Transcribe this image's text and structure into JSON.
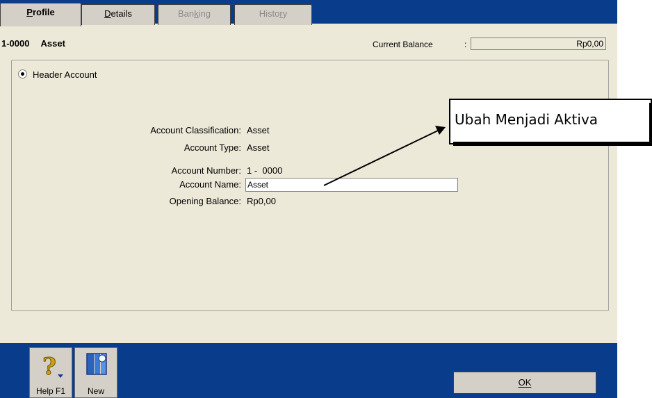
{
  "tabs": [
    {
      "label": "Profile",
      "state": "active"
    },
    {
      "label": "Details",
      "state": "enabled"
    },
    {
      "label": "Banking",
      "state": "disabled"
    },
    {
      "label": "History",
      "state": "disabled"
    }
  ],
  "account": {
    "number": "1-0000",
    "name": "Asset"
  },
  "balance": {
    "label": "Current Balance",
    "colon": ":",
    "value": "Rp0,00"
  },
  "header_account": {
    "label": "Header Account",
    "checked": true
  },
  "fields": {
    "classification": {
      "label": "Account Classification:",
      "value": "Asset"
    },
    "type": {
      "label": "Account Type:",
      "value": "Asset"
    },
    "number": {
      "label": "Account Number:",
      "value": "1 -  0000"
    },
    "name": {
      "label": "Account Name:",
      "value": "Asset"
    },
    "opening_balance": {
      "label": "Opening Balance:",
      "value": "Rp0,00"
    }
  },
  "toolbar": {
    "help_label": "Help F1",
    "new_label": "New",
    "ok_label": "OK"
  },
  "annotation": {
    "text": "Ubah Menjadi Aktiva"
  },
  "colors": {
    "window_blue": "#0a3c8c",
    "panel": "#ece9d8",
    "button": "#d4d0c8"
  },
  "icons": {
    "help": "question-mark-icon",
    "new": "new-account-icon"
  }
}
